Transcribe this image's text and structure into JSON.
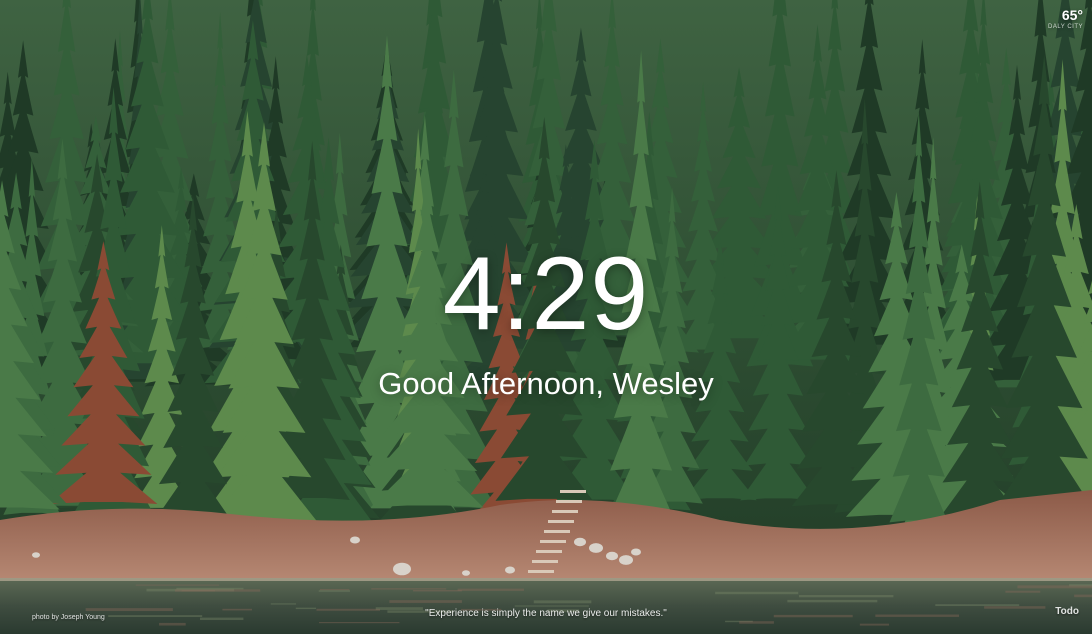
{
  "weather": {
    "temperature": "65°",
    "location": "DALY CITY"
  },
  "clock": {
    "time": "4:29"
  },
  "greeting": {
    "text": "Good Afternoon, ",
    "name": "Wesley"
  },
  "footer": {
    "photo_credit": "photo by Joseph Young",
    "quote": "\"Experience is simply the name we give our mistakes.\"",
    "todo_label": "Todo"
  },
  "background": {
    "description_icon": "forest-lake-photo",
    "sky_color": "#3a5a3a",
    "forest_dark": "#1f3a26",
    "forest_mid": "#2f5a36",
    "forest_light": "#5d8a4c",
    "rust_tree": "#8a4a34",
    "shore_color": "#9a6a55",
    "water_color": "#4d5a4a"
  }
}
